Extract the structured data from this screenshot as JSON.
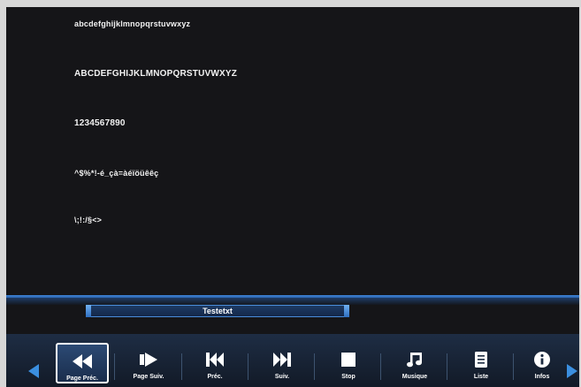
{
  "content": {
    "lines": [
      "abcdefghijklmnopqrstuvwxyz",
      "ABCDEFGHIJKLMNOPQRSTUVWXYZ",
      "1234567890",
      "^$%*!-é_çà=àéïöüêêç",
      "\\;!:/§<>"
    ]
  },
  "filename": "Testetxt",
  "controls": [
    {
      "label": "Page Préc.",
      "icon": "fast-rewind-icon"
    },
    {
      "label": "Page Suiv.",
      "icon": "play-forward-icon"
    },
    {
      "label": "Préc.",
      "icon": "skip-previous-icon"
    },
    {
      "label": "Suiv.",
      "icon": "skip-next-icon"
    },
    {
      "label": "Stop",
      "icon": "stop-icon"
    },
    {
      "label": "Musique",
      "icon": "music-note-icon"
    },
    {
      "label": "Liste",
      "icon": "list-icon"
    },
    {
      "label": "Infos",
      "icon": "info-icon"
    }
  ],
  "colors": {
    "accent": "#3b8fe0",
    "background": "#151518"
  }
}
